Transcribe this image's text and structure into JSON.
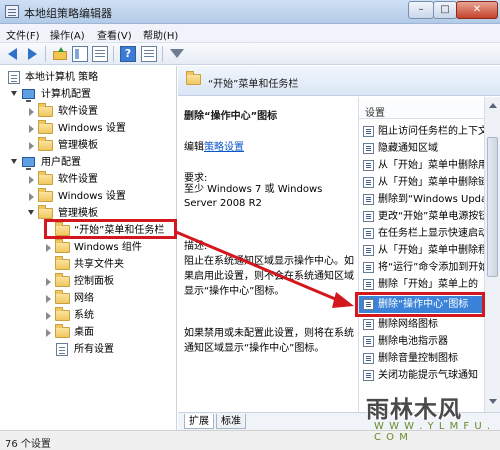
{
  "window": {
    "title": "本地组策略编辑器",
    "min_label": "–",
    "max_label": "□",
    "close_label": "✕"
  },
  "menu": [
    {
      "label": "文件(F)"
    },
    {
      "label": "操作(A)"
    },
    {
      "label": "查看(V)"
    },
    {
      "label": "帮助(H)"
    }
  ],
  "toolbar": {
    "icons": [
      "back-arrow-icon",
      "forward-arrow-icon",
      "up-folder-icon",
      "show-hide-tree-icon",
      "export-list-icon",
      "help-icon",
      "properties-sheet-icon",
      "filter-icon"
    ],
    "help_label": "?"
  },
  "tree": {
    "items": [
      {
        "label": "本地计算机 策略"
      },
      {
        "label": "计算机配置"
      },
      {
        "label": "软件设置"
      },
      {
        "label": "Windows 设置"
      },
      {
        "label": "管理模板"
      },
      {
        "label": "用户配置"
      },
      {
        "label": "软件设置"
      },
      {
        "label": "Windows 设置"
      },
      {
        "label": "管理模板"
      },
      {
        "label": "“开始”菜单和任务栏"
      },
      {
        "label": "Windows 组件"
      },
      {
        "label": "共享文件夹"
      },
      {
        "label": "控制面板"
      },
      {
        "label": "网络"
      },
      {
        "label": "系统"
      },
      {
        "label": "桌面"
      },
      {
        "label": "所有设置"
      }
    ]
  },
  "right": {
    "header": "“开始”菜单和任务栏",
    "desc_title": "删除“操作中心”图标",
    "edit_prefix": "编辑",
    "edit_link": "策略设置",
    "req_label": "要求:",
    "req_text": "至少 Windows 7 或 Windows Server 2008 R2",
    "desc_label": "描述:",
    "desc_body1": "阻止在系统通知区域显示操作中心。如果启用此设置，则不会在系统通知区域显示“操作中心”图标。",
    "desc_body2": "如果禁用或未配置此设置，则将在系统通知区域显示“操作中心”图标。",
    "column_header": "设置",
    "settings": [
      {
        "label": "阻止访问任务栏的上下文菜单"
      },
      {
        "label": "隐藏通知区域"
      },
      {
        "label": "从「开始」菜单中删除用户文件夹"
      },
      {
        "label": "从「开始」菜单中删除链接"
      },
      {
        "label": "删除到“Windows Update”的链接"
      },
      {
        "label": "更改“开始”菜单电源按钮"
      },
      {
        "label": "在任务栏上显示快速启动"
      },
      {
        "label": "从「开始」菜单中删除程序"
      },
      {
        "label": "将“运行”命令添加到开始菜单"
      },
      {
        "label": "删除「开始」菜单上的"
      },
      {
        "label": "删除“操作中心”图标"
      },
      {
        "label": "删除网络图标"
      },
      {
        "label": "删除电池指示器"
      },
      {
        "label": "删除音量控制图标"
      },
      {
        "label": "关闭功能提示气球通知"
      }
    ],
    "tabs": [
      {
        "label": "扩展"
      },
      {
        "label": "标准"
      }
    ]
  },
  "status": {
    "text": "76 个设置"
  },
  "watermark": {
    "main": "雨林木风",
    "sub": "W W W . Y L M F U . C O M"
  },
  "colors": {
    "highlight_red": "#d4161d",
    "selection_blue": "#3b83d9",
    "link_blue": "#0b57c9"
  }
}
